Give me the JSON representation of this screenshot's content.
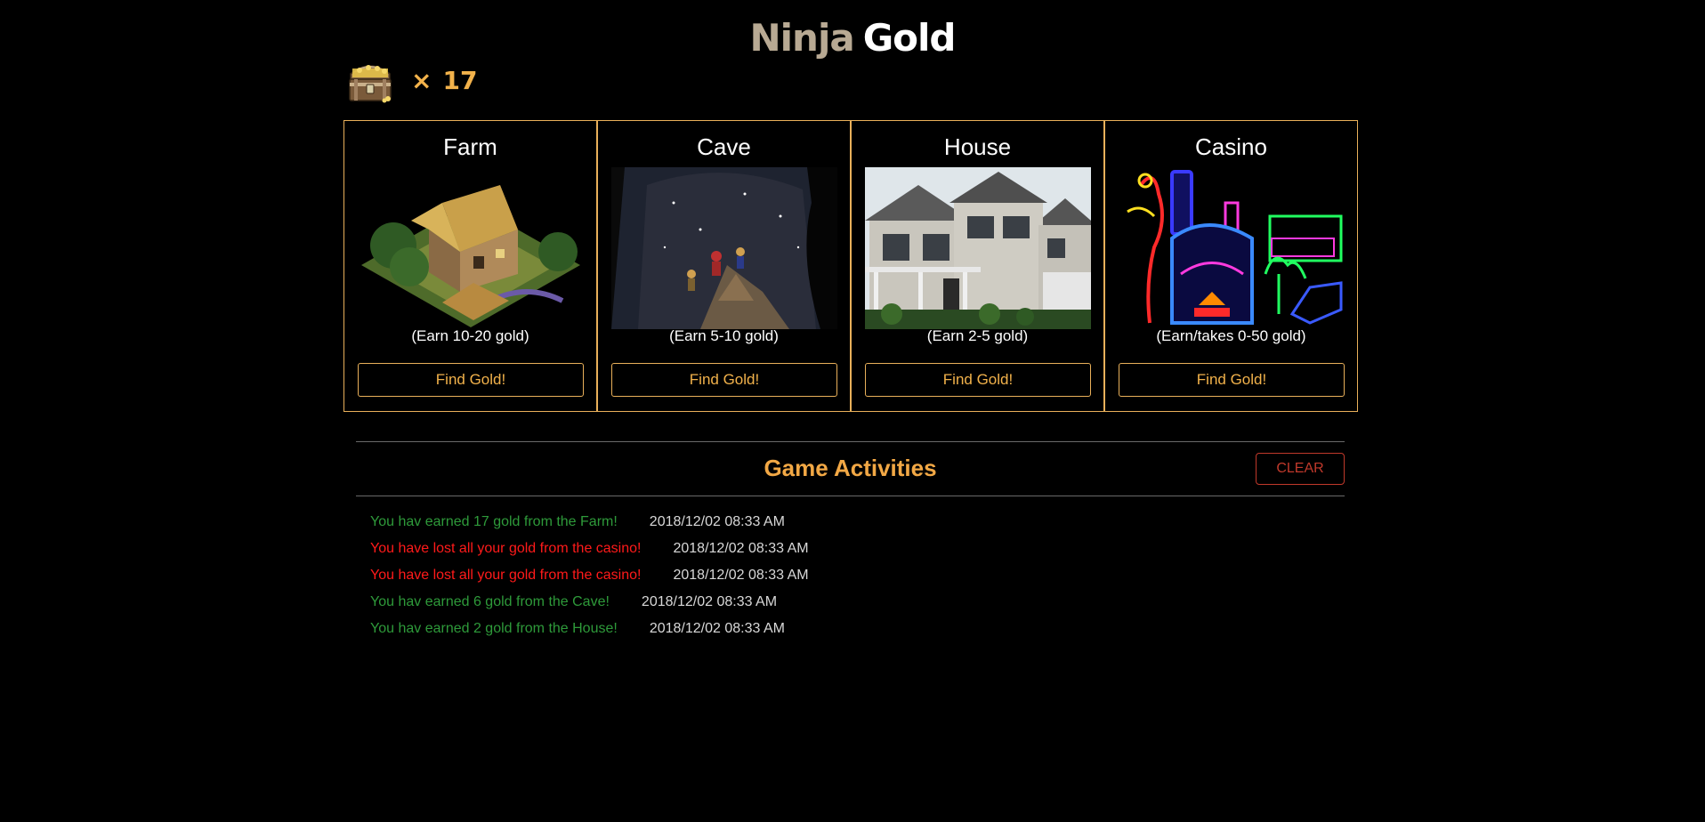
{
  "header": {
    "title_part1": "Ninja",
    "title_part2": "Gold"
  },
  "gold": {
    "multiplier": "×",
    "amount": "17"
  },
  "buildings": [
    {
      "name": "Farm",
      "earn": "(Earn 10-20 gold)",
      "button": "Find Gold!"
    },
    {
      "name": "Cave",
      "earn": "(Earn 5-10 gold)",
      "button": "Find Gold!"
    },
    {
      "name": "House",
      "earn": "(Earn 2-5 gold)",
      "button": "Find Gold!"
    },
    {
      "name": "Casino",
      "earn": "(Earn/takes 0-50 gold)",
      "button": "Find Gold!"
    }
  ],
  "activities": {
    "title": "Game Activities",
    "clear_label": "CLEAR",
    "entries": [
      {
        "message": "You hav earned 17 gold from the Farm!",
        "time": "2018/12/02 08:33 AM",
        "type": "win"
      },
      {
        "message": "You have lost all your gold from the casino!",
        "time": "2018/12/02 08:33 AM",
        "type": "lose"
      },
      {
        "message": "You have lost all your gold from the casino!",
        "time": "2018/12/02 08:33 AM",
        "type": "lose"
      },
      {
        "message": "You hav earned 6 gold from the Cave!",
        "time": "2018/12/02 08:33 AM",
        "type": "win"
      },
      {
        "message": "You hav earned 2 gold from the House!",
        "time": "2018/12/02 08:33 AM",
        "type": "win"
      }
    ]
  },
  "colors": {
    "accent": "#f2b24b",
    "border": "#e9b05a",
    "win": "#2e9a3a",
    "lose": "#ff1a1a",
    "clear": "#c0392b"
  }
}
